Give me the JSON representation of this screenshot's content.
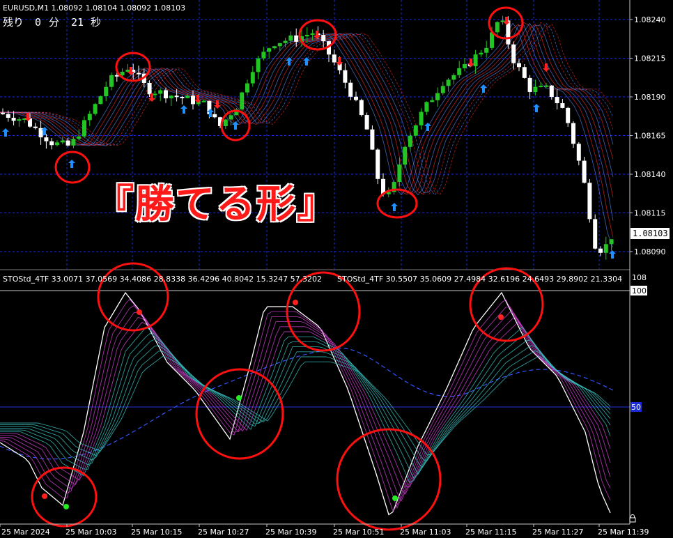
{
  "symbol_header": "EURUSD,M1  1.08092 1.08104 1.08092 1.08103",
  "countdown": {
    "label": "残り",
    "minutes": "0",
    "min_unit": "分",
    "seconds": "21",
    "sec_unit": "秒"
  },
  "headline": "『勝てる形』",
  "price_axis": {
    "ticks": [
      "1.08240",
      "1.08215",
      "1.08190",
      "1.08165",
      "1.08140",
      "1.08115",
      "1.08090"
    ],
    "current_price": "1.08103"
  },
  "indicator_header_1": "STOStd_4TF 33.0071 37.0569 34.4086 28.8338 36.4296 40.8042 15.3247 57.3202",
  "indicator_header_2": "STOStd_4TF 30.5507 35.0609 27.4984 32.6196 24.6493 29.8902 21.3304",
  "indicator_axis": {
    "top": "108",
    "upper": "100",
    "mid": "50"
  },
  "time_axis": [
    "25 Mar 2024",
    "25 Mar 10:03",
    "25 Mar 10:15",
    "25 Mar 10:27",
    "25 Mar 10:39",
    "25 Mar 10:51",
    "25 Mar 11:03",
    "25 Mar 11:15",
    "25 Mar 11:27",
    "25 Mar 11:39"
  ],
  "colors": {
    "background": "#000000",
    "bull": "#22c522",
    "bear": "#ffffff",
    "grid": "#1a2bd6",
    "highlight_circle": "#ff1010",
    "ribbon_up": "#5b8cff",
    "ribbon_down": "#ff2a2a",
    "osc_up": "#38c0c0",
    "osc_down": "#d040d0",
    "buy_arrow": "#1e90ff",
    "sell_arrow": "#ff2020"
  },
  "icons": {
    "buy_signal": "up-arrow-icon",
    "sell_signal": "down-arrow-icon",
    "lock": "lock-icon"
  }
}
